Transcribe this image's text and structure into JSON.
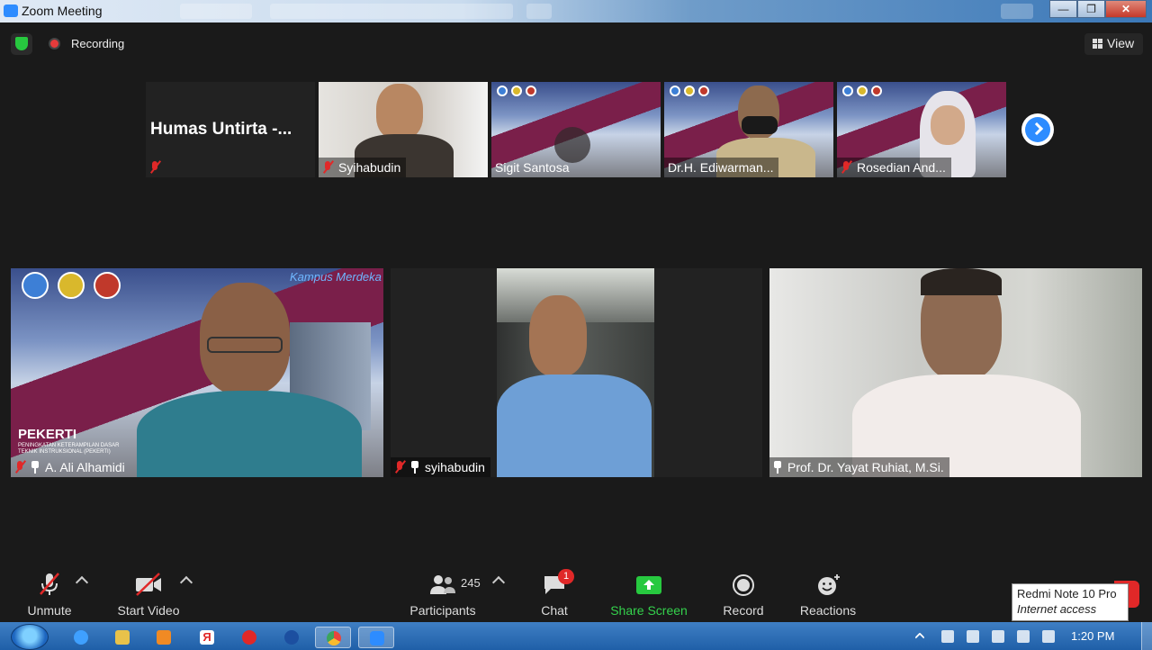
{
  "window": {
    "title": "Zoom Meeting"
  },
  "topbar": {
    "recording_label": "Recording",
    "view_label": "View"
  },
  "gallery_strip": [
    {
      "name": "Humas Untirta -...",
      "muted": true
    },
    {
      "name": "Syihabudin",
      "muted": true
    },
    {
      "name": "Sigit Santosa",
      "muted": false
    },
    {
      "name": "Dr.H.  Ediwarman...",
      "muted": false
    },
    {
      "name": "Rosedian And...",
      "muted": true
    }
  ],
  "main_tiles": [
    {
      "name": "A. Ali Alhamidi",
      "muted": true,
      "pinned": true,
      "banner_title": "PEKERTI",
      "banner_sub": "PENINGKATAN KETERAMPILAN DASAR TEKNIK INSTRUKSIONAL (PEKERTI)",
      "banner_brand": "Kampus Merdeka"
    },
    {
      "name": "syihabudin",
      "muted": true,
      "pinned": true
    },
    {
      "name": "Prof. Dr. Yayat Ruhiat, M.Si.",
      "muted": false,
      "pinned": true
    }
  ],
  "toolbar": {
    "unmute": "Unmute",
    "start_video": "Start Video",
    "participants": "Participants",
    "participants_count": "245",
    "chat": "Chat",
    "chat_badge": "1",
    "share_screen": "Share Screen",
    "record": "Record",
    "reactions": "Reactions"
  },
  "tooltip": {
    "title": "Redmi Note 10 Pro",
    "subtitle": "Internet access"
  },
  "taskbar": {
    "clock": "1:20 PM"
  },
  "colors": {
    "accent": "#2d8cff",
    "share_green": "#27c93f",
    "mute_red": "#e02828"
  }
}
